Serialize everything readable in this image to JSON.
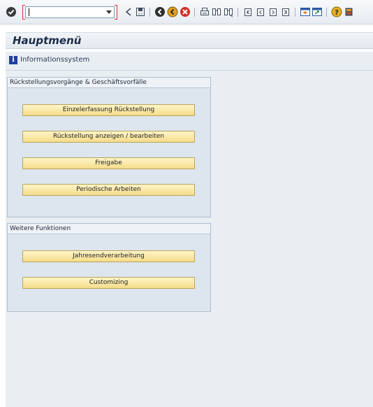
{
  "toolbar": {
    "command_field": {
      "value": "",
      "placeholder": ""
    },
    "icons": [
      "enter-icon",
      "back-arrow-icon",
      "save-icon",
      "back-icon",
      "exit-icon",
      "cancel-icon",
      "print-icon",
      "find-icon",
      "find-next-icon",
      "first-page-icon",
      "previous-page-icon",
      "next-page-icon",
      "last-page-icon",
      "create-session-icon",
      "shortcut-icon",
      "help-icon",
      "layout-menu-icon"
    ]
  },
  "title": "Hauptmenü",
  "appbar": {
    "info_label": "Informationssystem"
  },
  "groups": [
    {
      "header": "Rückstellungsvorgänge & Geschäftsvorfälle",
      "buttons": [
        "Einzelerfassung Rückstellung",
        "Rückstellung anzeigen / bearbeiten",
        "Freigabe",
        "Periodische Arbeiten"
      ]
    },
    {
      "header": "Weitere Funktionen",
      "buttons": [
        "Jahresendverarbeitung",
        "Customizing"
      ]
    }
  ],
  "colors": {
    "button_fill": "#f5dc8a",
    "panel_bg": "#dde6ee",
    "title_text": "#1b2b4a"
  }
}
